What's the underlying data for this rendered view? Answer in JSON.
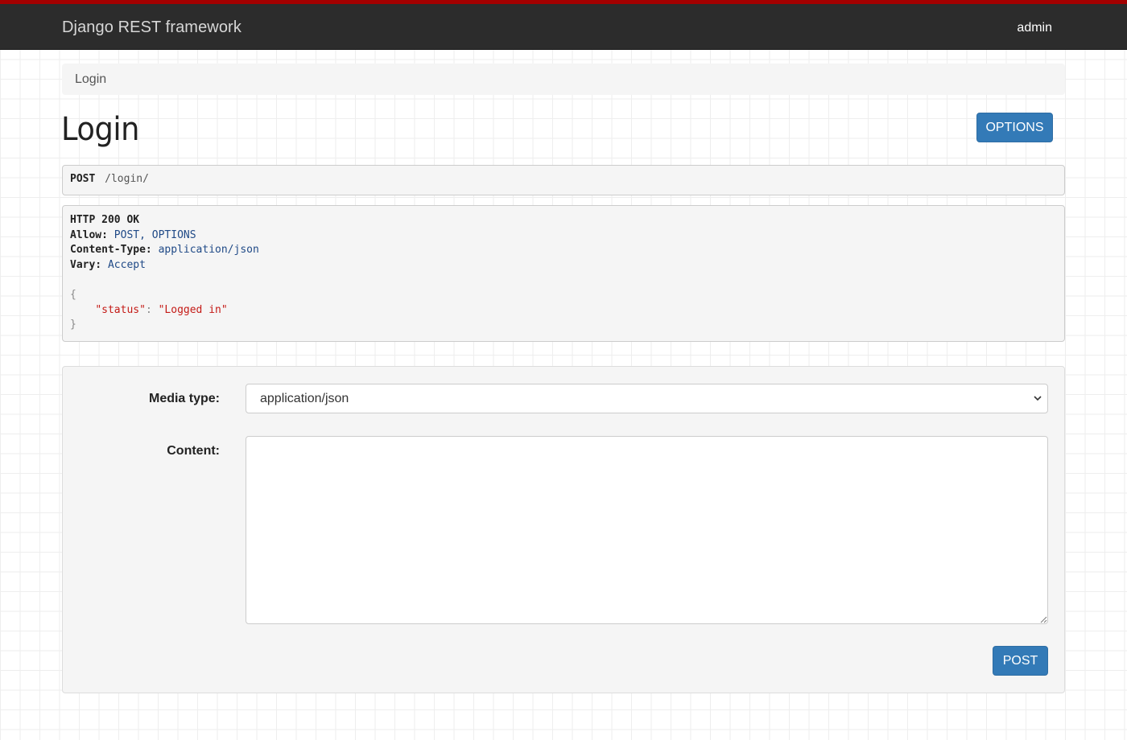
{
  "navbar": {
    "brand": "Django REST framework",
    "user": "admin",
    "accent_color": "#a30000",
    "background_color": "#2c2c2c"
  },
  "breadcrumb": {
    "items": [
      "Login"
    ]
  },
  "page": {
    "title": "Login",
    "options_label": "OPTIONS"
  },
  "request": {
    "method": "POST",
    "path": "/login/"
  },
  "response": {
    "status_line": "HTTP 200 OK",
    "headers": [
      {
        "key": "Allow:",
        "value": "POST, OPTIONS"
      },
      {
        "key": "Content-Type:",
        "value": "application/json"
      },
      {
        "key": "Vary:",
        "value": "Accept"
      }
    ],
    "body_open": "{",
    "body_key": "\"status\"",
    "body_sep": ": ",
    "body_value": "\"Logged in\"",
    "body_close": "}"
  },
  "form": {
    "media_type_label": "Media type:",
    "media_type_value": "application/json",
    "content_label": "Content:",
    "content_value": "",
    "submit_label": "POST",
    "button_color": "#337ab7"
  }
}
